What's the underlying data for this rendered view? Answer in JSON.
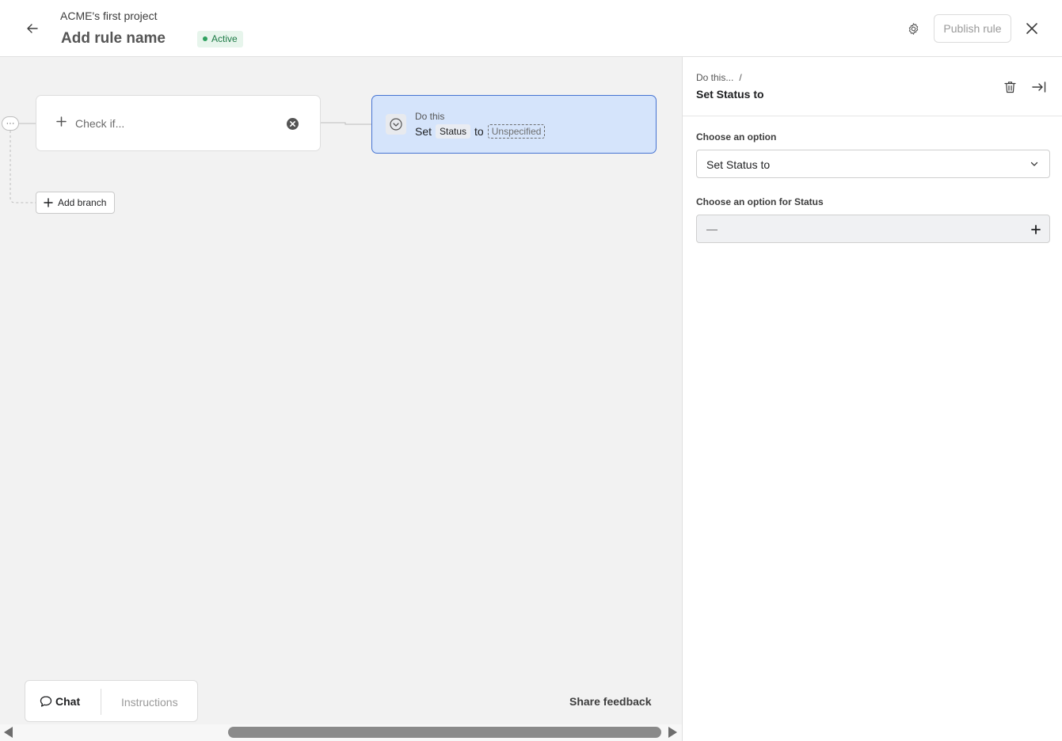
{
  "header": {
    "project_name": "ACME's first project",
    "rule_name": "Add rule name",
    "status": "Active",
    "publish_label": "Publish rule"
  },
  "canvas": {
    "check_label": "Check if...",
    "action_title": "Do this",
    "action_verb": "Set",
    "action_field": "Status",
    "action_connector": "to",
    "action_value": "Unspecified",
    "add_branch_label": "Add branch",
    "more_glyph": "···"
  },
  "bottom": {
    "chat_label": "Chat",
    "instructions_label": "Instructions",
    "share_feedback_label": "Share feedback"
  },
  "panel": {
    "breadcrumb": "Do this...",
    "breadcrumb_sep": "/",
    "title": "Set Status to",
    "option_label": "Choose an option",
    "option_value": "Set Status to",
    "status_label": "Choose an option for Status",
    "status_value": "—"
  },
  "icons": {
    "back": "arrow-left-icon",
    "settings": "gear-icon",
    "close": "close-icon",
    "more": "ellipsis-icon",
    "add": "plus-icon",
    "clear": "clear-circle-icon",
    "action": "chevron-circle-icon",
    "chat": "chat-bubble-icon",
    "trash": "trash-icon",
    "collapse": "collapse-panel-icon",
    "dropdown": "chevron-down-icon"
  },
  "colors": {
    "accent": "#4573d2",
    "action_card_bg": "#d5e4fb",
    "active_badge_bg": "#e7f5ec",
    "active_badge_text": "#1d7a46",
    "canvas_bg": "#f2f2f2"
  }
}
